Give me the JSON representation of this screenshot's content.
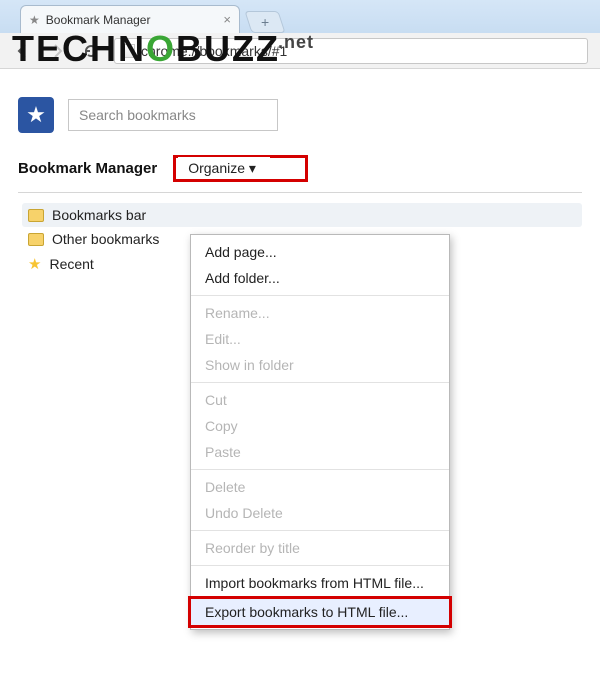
{
  "tab": {
    "title": "Bookmark Manager"
  },
  "omnibox": {
    "url": "chrome://bookmarks/#1"
  },
  "watermark": {
    "brand_pre": "TECHN",
    "brand_post": "BUZZ",
    "ext": ".net"
  },
  "search": {
    "placeholder": "Search bookmarks"
  },
  "subheader": {
    "title": "Bookmark Manager",
    "organize_label": "Organize"
  },
  "tree": {
    "items": [
      {
        "label": "Bookmarks bar"
      },
      {
        "label": "Other bookmarks"
      },
      {
        "label": "Recent"
      }
    ]
  },
  "menu": {
    "add_page": "Add page...",
    "add_folder": "Add folder...",
    "rename": "Rename...",
    "edit": "Edit...",
    "show_in_folder": "Show in folder",
    "cut": "Cut",
    "copy": "Copy",
    "paste": "Paste",
    "delete": "Delete",
    "undo_delete": "Undo Delete",
    "reorder": "Reorder by title",
    "import": "Import bookmarks from HTML file...",
    "export": "Export bookmarks to HTML file..."
  }
}
